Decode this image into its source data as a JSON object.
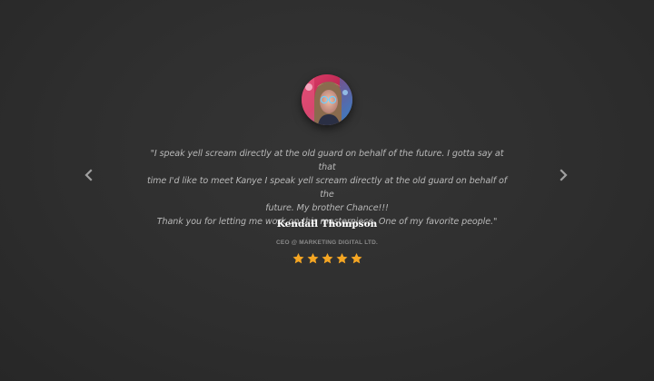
{
  "testimonial": {
    "quote_line1": "\"I speak yell scream directly at the old guard on behalf of the future. I gotta say at that",
    "quote_line2": "time I'd like to meet Kanye I speak yell scream directly at the old guard on behalf of the",
    "quote_line3": "future. My brother Chance!!!",
    "quote_line4": "Thank you for letting me work on this masterpiece. One of my favorite people.\"",
    "name": "Kendall Thompson",
    "role": "CEO @ MARKETING DIGITAL LTD.",
    "rating": 5,
    "rating_max": 5
  },
  "navigation": {
    "prev_icon": "chevron-left-icon",
    "next_icon": "chevron-right-icon"
  },
  "colors": {
    "background": "#2e2e2e",
    "star": "#f5a623",
    "text_quote": "#b8b8b8",
    "text_name": "#ffffff",
    "text_role": "#8a8a8a",
    "arrow": "#a0a0a0"
  }
}
